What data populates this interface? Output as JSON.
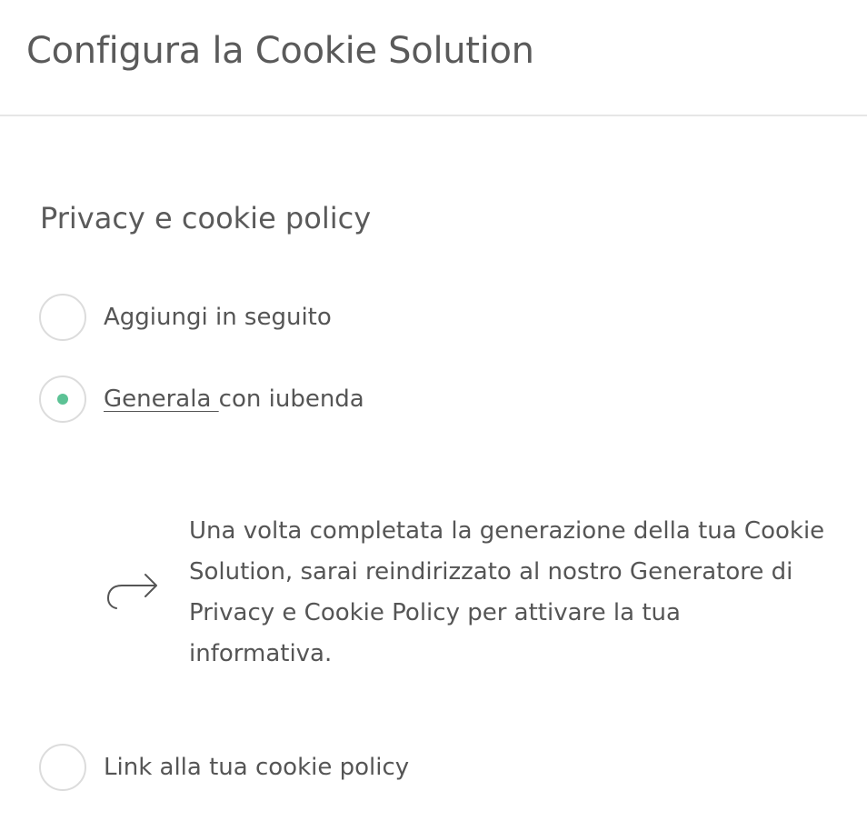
{
  "header": {
    "title": "Configura la Cookie Solution"
  },
  "section": {
    "title": "Privacy e cookie policy"
  },
  "options": [
    {
      "label": "Aggiungi in seguito",
      "selected": false
    },
    {
      "link_label": "Generala ",
      "label_rest": "con iubenda",
      "selected": true
    },
    {
      "label": "Link alla tua cookie policy",
      "selected": false
    }
  ],
  "info": {
    "icon": "redirect-arrow-icon",
    "text": "Una volta completata la generazione della tua Cookie Solution, sarai reindirizzato al nostro Generatore di Privacy e Cookie Policy per attivare la tua informativa."
  },
  "colors": {
    "accent": "#5cc295",
    "text": "#555555",
    "border": "#dcdcdc",
    "divider": "#e6e6e6"
  }
}
